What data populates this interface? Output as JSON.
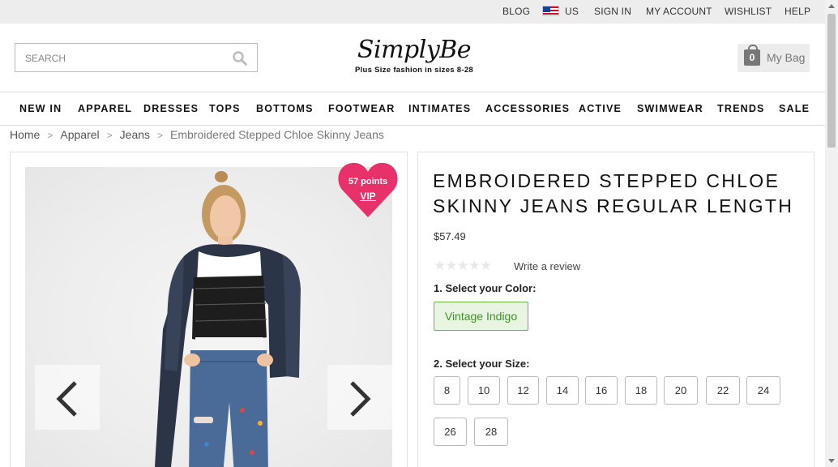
{
  "topbar": {
    "blog": "BLOG",
    "country": "US",
    "country_flag_icon": "us-flag-icon",
    "sign_in": "SIGN IN",
    "my_account": "MY ACCOUNT",
    "wishlist": "WISHLIST",
    "help": "HELP"
  },
  "header": {
    "search_placeholder": "SEARCH",
    "logo": "SimplyBe",
    "tagline": "Plus Size fashion in sizes 8-28",
    "bag_count": "0",
    "bag_label": "My Bag"
  },
  "nav": {
    "items": [
      "NEW IN",
      "APPAREL",
      "DRESSES",
      "TOPS",
      "BOTTOMS",
      "FOOTWEAR",
      "INTIMATES",
      "ACCESSORIES",
      "ACTIVE",
      "SWIMWEAR",
      "TRENDS",
      "SALE"
    ]
  },
  "breadcrumb": {
    "items": [
      "Home",
      "Apparel",
      "Jeans"
    ],
    "separator": ">",
    "current": "Embroidered Stepped Chloe Skinny Jeans"
  },
  "gallery": {
    "points": "57 points",
    "vip": "VIP",
    "heart_color": "#e8316a"
  },
  "product": {
    "title": "EMBROIDERED STEPPED CHLOE SKINNY JEANS REGULAR LENGTH",
    "price": "$57.49",
    "stars": "★★★★★",
    "rating": 0,
    "write_review": "Write a review",
    "color_label": "1. Select your Color:",
    "color_selected": "Vintage Indigo",
    "size_label": "2. Select your Size:",
    "sizes": [
      "8",
      "10",
      "12",
      "14",
      "16",
      "18",
      "20",
      "22",
      "24",
      "26",
      "28"
    ]
  },
  "colors": {
    "accent_green": "#3f8f25",
    "topbar_bg": "#ededed"
  }
}
